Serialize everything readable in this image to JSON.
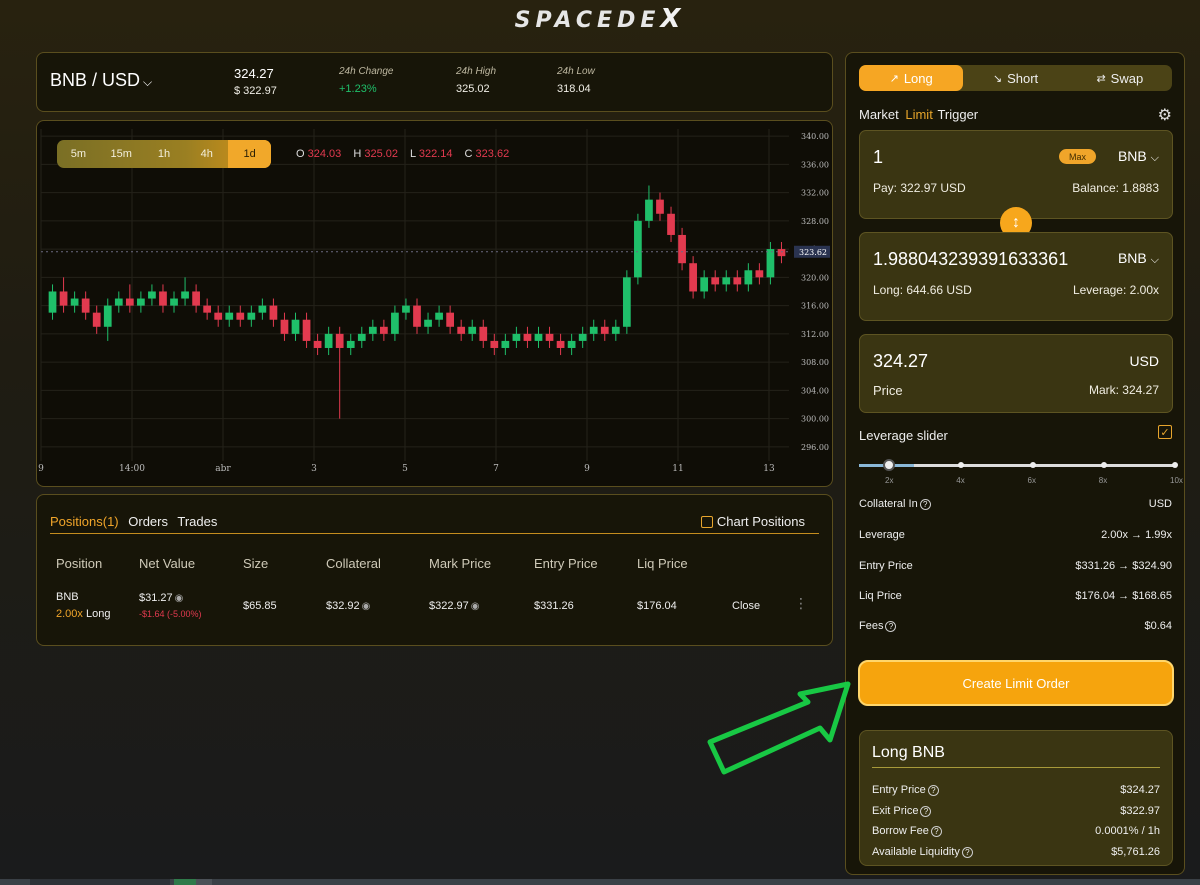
{
  "brand": {
    "name": "SPACEDE",
    "x": "X"
  },
  "header": {
    "pair": "BNB / USD",
    "price": "324.27",
    "price_usd": "$ 322.97",
    "change_label": "24h Change",
    "change_value": "+1.23%",
    "high_label": "24h High",
    "high_value": "325.02",
    "low_label": "24h Low",
    "low_value": "318.04"
  },
  "chart": {
    "timeframes": [
      "5m",
      "15m",
      "1h",
      "4h",
      "1d"
    ],
    "active_timeframe": "1d",
    "ohlc": {
      "o": "324.03",
      "h": "325.02",
      "l": "322.14",
      "c": "323.62"
    },
    "current_price_tag": "323.62"
  },
  "chart_data": {
    "type": "candlestick",
    "y_ticks": [
      "340.00",
      "336.00",
      "332.00",
      "328.00",
      "324.00",
      "320.00",
      "316.00",
      "312.00",
      "308.00",
      "304.00",
      "300.00",
      "296.00"
    ],
    "ylim": [
      294,
      341
    ],
    "x_ticks": [
      "9",
      "14:00",
      "abr",
      "3",
      "5",
      "7",
      "9",
      "11",
      "13"
    ],
    "colors": {
      "up": "#1fbf6a",
      "down": "#e23a4f"
    },
    "candles": [
      [
        315,
        318,
        314,
        319
      ],
      [
        318,
        316,
        315,
        320
      ],
      [
        316,
        317,
        315,
        318
      ],
      [
        317,
        315,
        314,
        318
      ],
      [
        315,
        313,
        312,
        316
      ],
      [
        313,
        316,
        311,
        317
      ],
      [
        316,
        317,
        315,
        318
      ],
      [
        317,
        316,
        315,
        319
      ],
      [
        316,
        317,
        315,
        318
      ],
      [
        317,
        318,
        316,
        319
      ],
      [
        318,
        316,
        315,
        319
      ],
      [
        316,
        317,
        315,
        318
      ],
      [
        317,
        318,
        316,
        320
      ],
      [
        318,
        316,
        315,
        319
      ],
      [
        316,
        315,
        314,
        317
      ],
      [
        315,
        314,
        313,
        316
      ],
      [
        314,
        315,
        313,
        316
      ],
      [
        315,
        314,
        313,
        316
      ],
      [
        314,
        315,
        313,
        316
      ],
      [
        315,
        316,
        314,
        317
      ],
      [
        316,
        314,
        313,
        317
      ],
      [
        314,
        312,
        311,
        315
      ],
      [
        312,
        314,
        311,
        315
      ],
      [
        314,
        311,
        310,
        315
      ],
      [
        311,
        310,
        309,
        312
      ],
      [
        310,
        312,
        309,
        313
      ],
      [
        312,
        310,
        300,
        313
      ],
      [
        310,
        311,
        309,
        312
      ],
      [
        311,
        312,
        310,
        313
      ],
      [
        312,
        313,
        311,
        314
      ],
      [
        313,
        312,
        311,
        314
      ],
      [
        312,
        315,
        311,
        316
      ],
      [
        315,
        316,
        314,
        317
      ],
      [
        316,
        313,
        312,
        317
      ],
      [
        313,
        314,
        312,
        315
      ],
      [
        314,
        315,
        313,
        316
      ],
      [
        315,
        313,
        312,
        316
      ],
      [
        313,
        312,
        311,
        314
      ],
      [
        312,
        313,
        311,
        314
      ],
      [
        313,
        311,
        310,
        314
      ],
      [
        311,
        310,
        309,
        312
      ],
      [
        310,
        311,
        309,
        312
      ],
      [
        311,
        312,
        310,
        313
      ],
      [
        312,
        311,
        310,
        313
      ],
      [
        311,
        312,
        310,
        313
      ],
      [
        312,
        311,
        310,
        313
      ],
      [
        311,
        310,
        309,
        312
      ],
      [
        310,
        311,
        309,
        312
      ],
      [
        311,
        312,
        310,
        313
      ],
      [
        312,
        313,
        311,
        314
      ],
      [
        313,
        312,
        311,
        314
      ],
      [
        312,
        313,
        311,
        314
      ],
      [
        313,
        320,
        312,
        321
      ],
      [
        320,
        328,
        319,
        329
      ],
      [
        328,
        331,
        327,
        333
      ],
      [
        331,
        329,
        328,
        332
      ],
      [
        329,
        326,
        325,
        330
      ],
      [
        326,
        322,
        321,
        327
      ],
      [
        322,
        318,
        317,
        323
      ],
      [
        318,
        320,
        317,
        321
      ],
      [
        320,
        319,
        318,
        321
      ],
      [
        319,
        320,
        318,
        321
      ],
      [
        320,
        319,
        318,
        321
      ],
      [
        319,
        321,
        318,
        322
      ],
      [
        321,
        320,
        319,
        322
      ],
      [
        320,
        324,
        319,
        325
      ],
      [
        324,
        323,
        322,
        325
      ]
    ]
  },
  "positions": {
    "tabs": [
      "Positions(1)",
      "Orders",
      "Trades"
    ],
    "chart_positions": "Chart Positions",
    "columns": [
      "Position",
      "Net Value",
      "Size",
      "Collateral",
      "Mark Price",
      "Entry Price",
      "Liq Price"
    ],
    "row": {
      "asset": "BNB",
      "leverage": "2.00x",
      "side": "Long",
      "net_value": "$31.27",
      "pnl": "-$1.64 (-5.00%)",
      "size": "$65.85",
      "collateral": "$32.92",
      "mark_price": "$322.97",
      "entry_price": "$331.26",
      "liq_price": "$176.04",
      "close": "Close"
    }
  },
  "trade": {
    "modes": [
      "Long",
      "Short",
      "Swap"
    ],
    "mode_icons": [
      "↗",
      "↘",
      "⇄"
    ],
    "order_types": [
      "Market",
      "Limit",
      "Trigger"
    ],
    "pay_amount": "1",
    "max": "Max",
    "pay_token": "BNB",
    "pay_label": "Pay: 322.97 USD",
    "balance_label": "Balance: 1.8883",
    "long_amount": "1.988043239391633361",
    "long_token": "BNB",
    "long_label": "Long: 644.66 USD",
    "leverage_label": "Leverage: 2.00x",
    "price_value": "324.27",
    "price_currency": "USD",
    "price_label": "Price",
    "mark_label": "Mark: 324.27",
    "leverage_slider": "Leverage slider",
    "slider_ticks": [
      "2x",
      "4x",
      "6x",
      "8x",
      "10x"
    ],
    "slider_value": 0.11,
    "details": [
      {
        "label": "Collateral In",
        "value": "USD",
        "help": true
      },
      {
        "label": "Leverage",
        "value": "2.00x → 1.99x",
        "help": false
      },
      {
        "label": "Entry Price",
        "value": "$331.26 → $324.90",
        "help": false
      },
      {
        "label": "Liq Price",
        "value": "$176.04 → $168.65",
        "help": false
      },
      {
        "label": "Fees",
        "value": "$0.64",
        "help": true
      }
    ],
    "create_button": "Create Limit Order"
  },
  "summary": {
    "title": "Long BNB",
    "rows": [
      {
        "label": "Entry Price",
        "value": "$324.27"
      },
      {
        "label": "Exit Price",
        "value": "$322.97"
      },
      {
        "label": "Borrow Fee",
        "value": "0.0001% / 1h"
      },
      {
        "label": "Available Liquidity",
        "value": "$5,761.26"
      }
    ]
  }
}
